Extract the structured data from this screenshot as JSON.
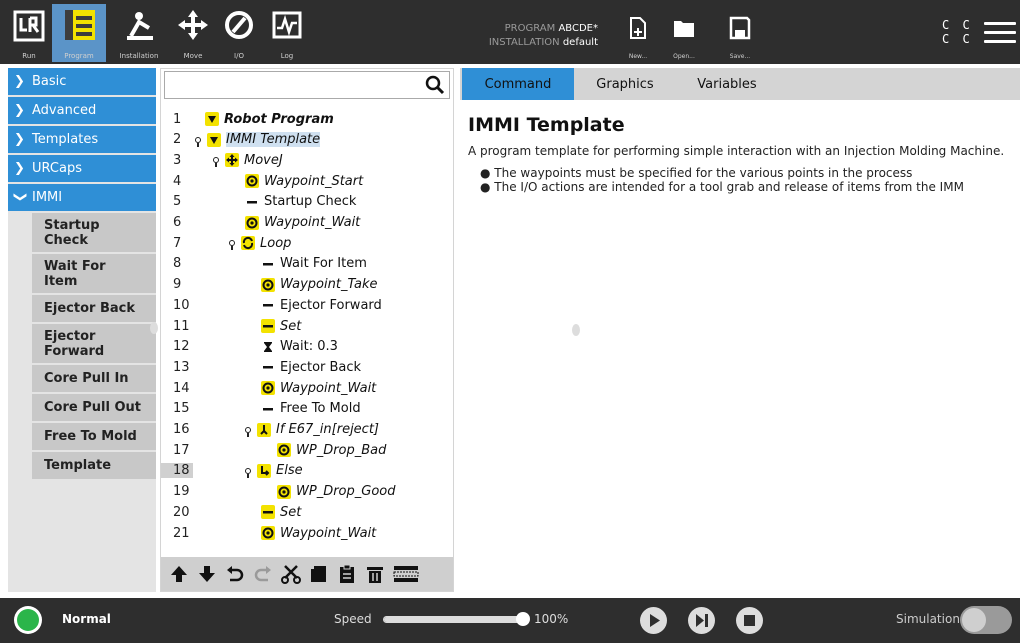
{
  "topbar": {
    "nav": [
      {
        "label": "Run",
        "icon": "ur-logo-icon"
      },
      {
        "label": "Program",
        "icon": "program-icon",
        "active": true
      },
      {
        "label": "Installation",
        "icon": "installation-icon"
      },
      {
        "label": "Move",
        "icon": "move-icon"
      },
      {
        "label": "I/O",
        "icon": "io-icon"
      },
      {
        "label": "Log",
        "icon": "log-icon"
      }
    ],
    "program_key": "PROGRAM",
    "program_value": "ABCDE*",
    "installation_key": "INSTALLATION",
    "installation_value": "default",
    "file_buttons": [
      {
        "label": "New..."
      },
      {
        "label": "Open..."
      },
      {
        "label": "Save..."
      }
    ],
    "cc_line1": "C C",
    "cc_line2": "C C"
  },
  "left_panel": {
    "categories": [
      {
        "label": "Basic",
        "expanded": false
      },
      {
        "label": "Advanced",
        "expanded": false
      },
      {
        "label": "Templates",
        "expanded": false
      },
      {
        "label": "URCaps",
        "expanded": false
      },
      {
        "label": "IMMI",
        "expanded": true
      }
    ],
    "immi_items": [
      "Startup Check",
      "Wait For Item",
      "Ejector Back",
      "Ejector Forward",
      "Core Pull In",
      "Core Pull Out",
      "Free To Mold",
      "Template"
    ]
  },
  "tree": {
    "rows": [
      {
        "n": "1",
        "label": "Robot Program",
        "icon": "triangle-down-icon"
      },
      {
        "n": "2",
        "label": "IMMI Template",
        "icon": "triangle-down-icon"
      },
      {
        "n": "3",
        "label": "MoveJ",
        "icon": "move-icon"
      },
      {
        "n": "4",
        "label": "Waypoint_Start",
        "icon": "waypoint-icon"
      },
      {
        "n": "5",
        "label": "Startup Check",
        "icon": "command-icon"
      },
      {
        "n": "6",
        "label": "Waypoint_Wait",
        "icon": "waypoint-icon"
      },
      {
        "n": "7",
        "label": "Loop",
        "icon": "loop-icon"
      },
      {
        "n": "8",
        "label": "Wait For Item",
        "icon": "command-icon"
      },
      {
        "n": "9",
        "label": "Waypoint_Take",
        "icon": "waypoint-icon"
      },
      {
        "n": "10",
        "label": "Ejector Forward",
        "icon": "command-icon"
      },
      {
        "n": "11",
        "label": "Set",
        "icon": "set-icon"
      },
      {
        "n": "12",
        "label": "Wait: 0.3",
        "icon": "hourglass-icon"
      },
      {
        "n": "13",
        "label": "Ejector Back",
        "icon": "command-icon"
      },
      {
        "n": "14",
        "label": "Waypoint_Wait",
        "icon": "waypoint-icon"
      },
      {
        "n": "15",
        "label": "Free To Mold",
        "icon": "command-icon"
      },
      {
        "n": "16",
        "label": "If E67_in[reject]",
        "icon": "if-icon"
      },
      {
        "n": "17",
        "label": "WP_Drop_Bad",
        "icon": "waypoint-icon"
      },
      {
        "n": "18",
        "label": "Else",
        "icon": "else-icon"
      },
      {
        "n": "19",
        "label": "WP_Drop_Good",
        "icon": "waypoint-icon"
      },
      {
        "n": "20",
        "label": "Set",
        "icon": "set-icon"
      },
      {
        "n": "21",
        "label": "Waypoint_Wait",
        "icon": "waypoint-icon"
      }
    ],
    "toolbar": [
      "move-up-icon",
      "move-down-icon",
      "undo-icon",
      "redo-icon",
      "cut-icon",
      "copy-icon",
      "paste-icon",
      "delete-icon",
      "suppress-icon"
    ]
  },
  "main": {
    "tabs": [
      {
        "label": "Command",
        "active": true
      },
      {
        "label": "Graphics"
      },
      {
        "label": "Variables"
      }
    ],
    "title": "IMMI Template",
    "description": "A program template for performing simple interaction with an Injection Molding Machine.",
    "bullets": [
      "The waypoints must be specified for the various points in the process",
      "The I/O actions are intended for a tool grab and release of items from the IMM"
    ]
  },
  "bottom": {
    "status": "Normal",
    "speed_label": "Speed",
    "speed_value": "100%",
    "speed_fraction": 1.0,
    "simulation_label": "Simulation"
  },
  "colors": {
    "accent": "#2f8fd6",
    "topbar": "#2e2e2e",
    "yellow": "#f3e200",
    "status_green": "#2bb54a"
  }
}
